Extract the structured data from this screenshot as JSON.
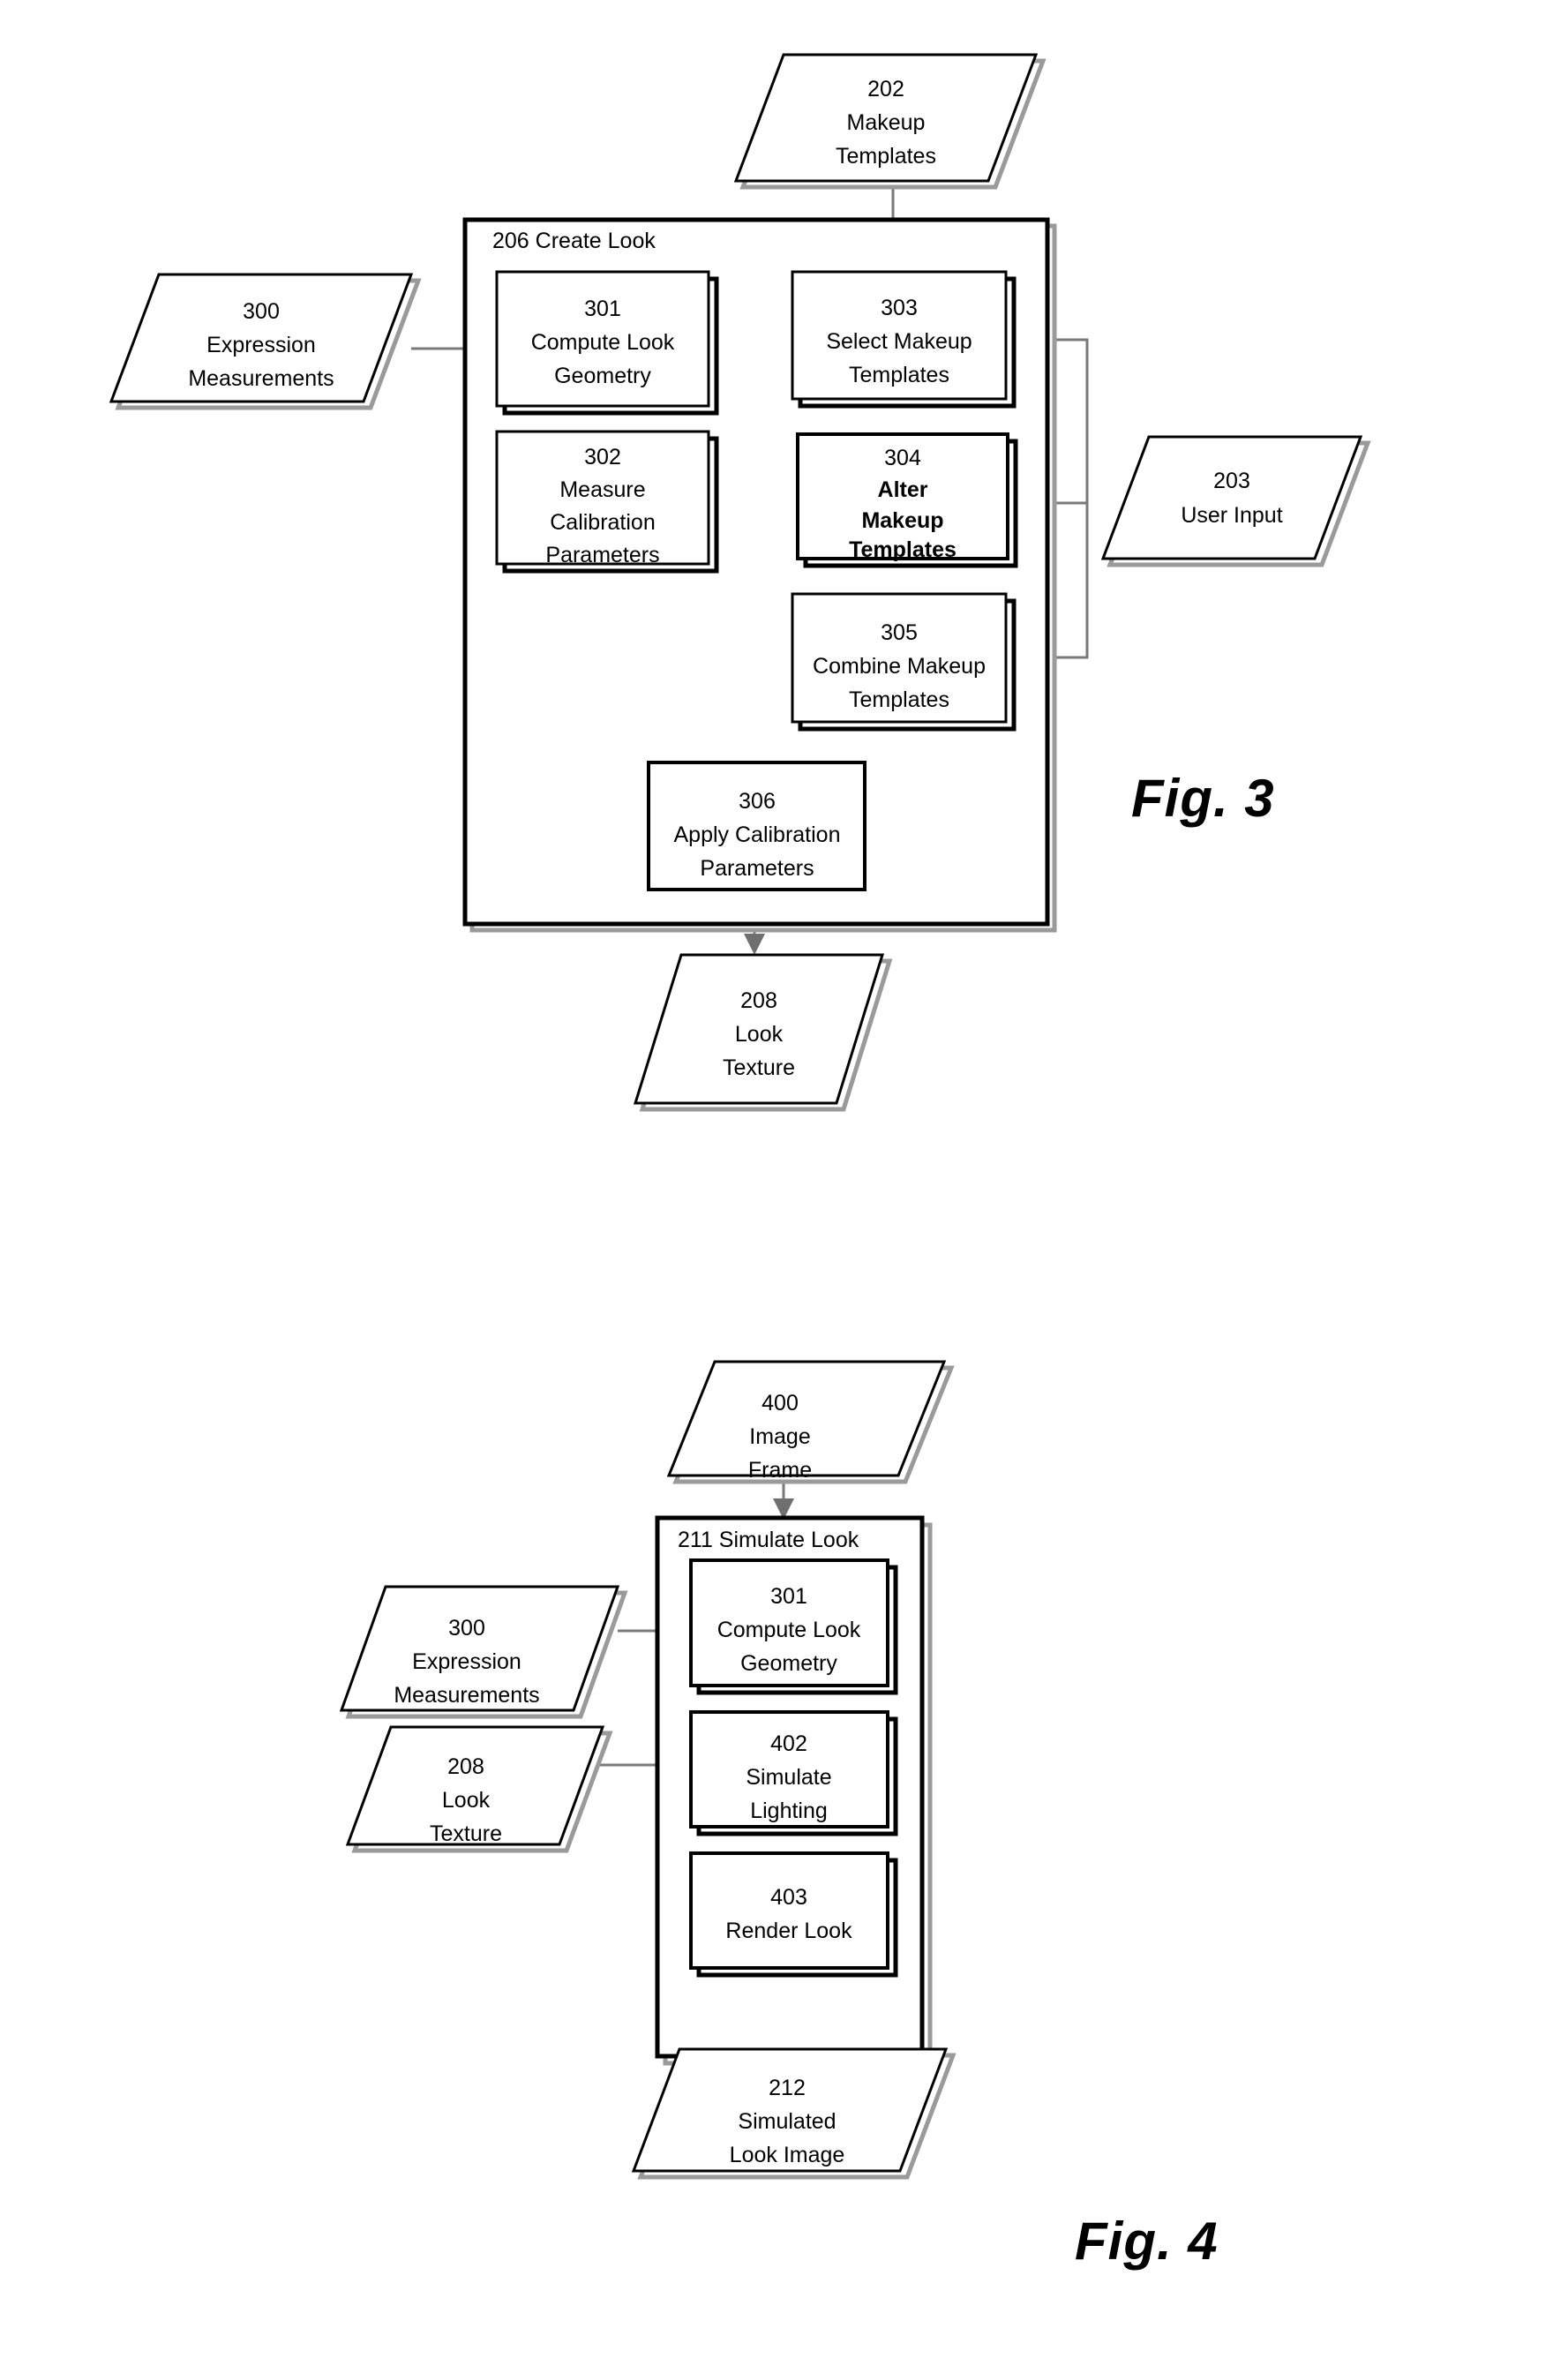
{
  "sheet": {
    "title": "Patent Flowchart Sheet — Figures 3 and 4",
    "background_color": "#ffffff",
    "line_color": "#000000",
    "text_color": "#000000"
  },
  "figures": [
    {
      "id": "fig3",
      "label": "Fig. 3",
      "container": {
        "id": "206",
        "title": "206 Create Look"
      },
      "nodes": [
        {
          "id": "202",
          "shape": "parallelogram",
          "number": "202",
          "lines": [
            "Makeup",
            "Templates"
          ],
          "bold": false
        },
        {
          "id": "300",
          "shape": "parallelogram",
          "number": "300",
          "lines": [
            "Expression",
            "Measurements"
          ],
          "bold": false
        },
        {
          "id": "203",
          "shape": "parallelogram",
          "number": "203",
          "lines": [
            "User Input"
          ],
          "bold": false
        },
        {
          "id": "208",
          "shape": "parallelogram",
          "number": "208",
          "lines": [
            "Look",
            "Texture"
          ],
          "bold": false
        },
        {
          "id": "301",
          "shape": "process",
          "number": "301",
          "lines": [
            "Compute Look",
            "Geometry"
          ],
          "bold": false
        },
        {
          "id": "302",
          "shape": "process",
          "number": "302",
          "lines": [
            "Measure",
            "Calibration",
            "Parameters"
          ],
          "bold": false
        },
        {
          "id": "303",
          "shape": "process",
          "number": "303",
          "lines": [
            "Select Makeup",
            "Templates"
          ],
          "bold": false
        },
        {
          "id": "304",
          "shape": "process",
          "number": "304",
          "lines": [
            "Alter",
            "Makeup",
            "Templates"
          ],
          "bold": true
        },
        {
          "id": "305",
          "shape": "process",
          "number": "305",
          "lines": [
            "Combine Makeup",
            "Templates"
          ],
          "bold": false
        },
        {
          "id": "306",
          "shape": "process",
          "number": "306",
          "lines": [
            "Apply Calibration",
            "Parameters"
          ],
          "bold": false
        }
      ],
      "edges": [
        {
          "from": "202",
          "to": "303"
        },
        {
          "from": "300",
          "to": "301"
        },
        {
          "from": "301",
          "to": "302"
        },
        {
          "from": "302",
          "to": "306"
        },
        {
          "from": "303",
          "to": "304"
        },
        {
          "from": "304",
          "to": "305"
        },
        {
          "from": "305",
          "to": "306"
        },
        {
          "from": "203",
          "to": "303"
        },
        {
          "from": "203",
          "to": "304"
        },
        {
          "from": "203",
          "to": "305"
        },
        {
          "from": "306",
          "to": "208"
        }
      ]
    },
    {
      "id": "fig4",
      "label": "Fig. 4",
      "container": {
        "id": "211",
        "title": "211 Simulate Look"
      },
      "nodes": [
        {
          "id": "400",
          "shape": "parallelogram",
          "number": "400",
          "lines": [
            "Image",
            "Frame"
          ],
          "bold": false
        },
        {
          "id": "300b",
          "shape": "parallelogram",
          "number": "300",
          "lines": [
            "Expression",
            "Measurements"
          ],
          "bold": false
        },
        {
          "id": "208b",
          "shape": "parallelogram",
          "number": "208",
          "lines": [
            "Look",
            "Texture"
          ],
          "bold": false
        },
        {
          "id": "212",
          "shape": "parallelogram",
          "number": "212",
          "lines": [
            "Simulated",
            "Look Image"
          ],
          "bold": false
        },
        {
          "id": "301b",
          "shape": "process",
          "number": "301",
          "lines": [
            "Compute Look",
            "Geometry"
          ],
          "bold": false
        },
        {
          "id": "402",
          "shape": "process",
          "number": "402",
          "lines": [
            "Simulate",
            "Lighting"
          ],
          "bold": false
        },
        {
          "id": "403",
          "shape": "process",
          "number": "403",
          "lines": [
            "Render Look"
          ],
          "bold": false
        }
      ],
      "edges": [
        {
          "from": "400",
          "to": "211"
        },
        {
          "from": "300b",
          "to": "301b"
        },
        {
          "from": "208b",
          "to": "402"
        },
        {
          "from": "301b",
          "to": "402"
        },
        {
          "from": "402",
          "to": "403"
        },
        {
          "from": "403",
          "to": "212"
        }
      ]
    }
  ]
}
